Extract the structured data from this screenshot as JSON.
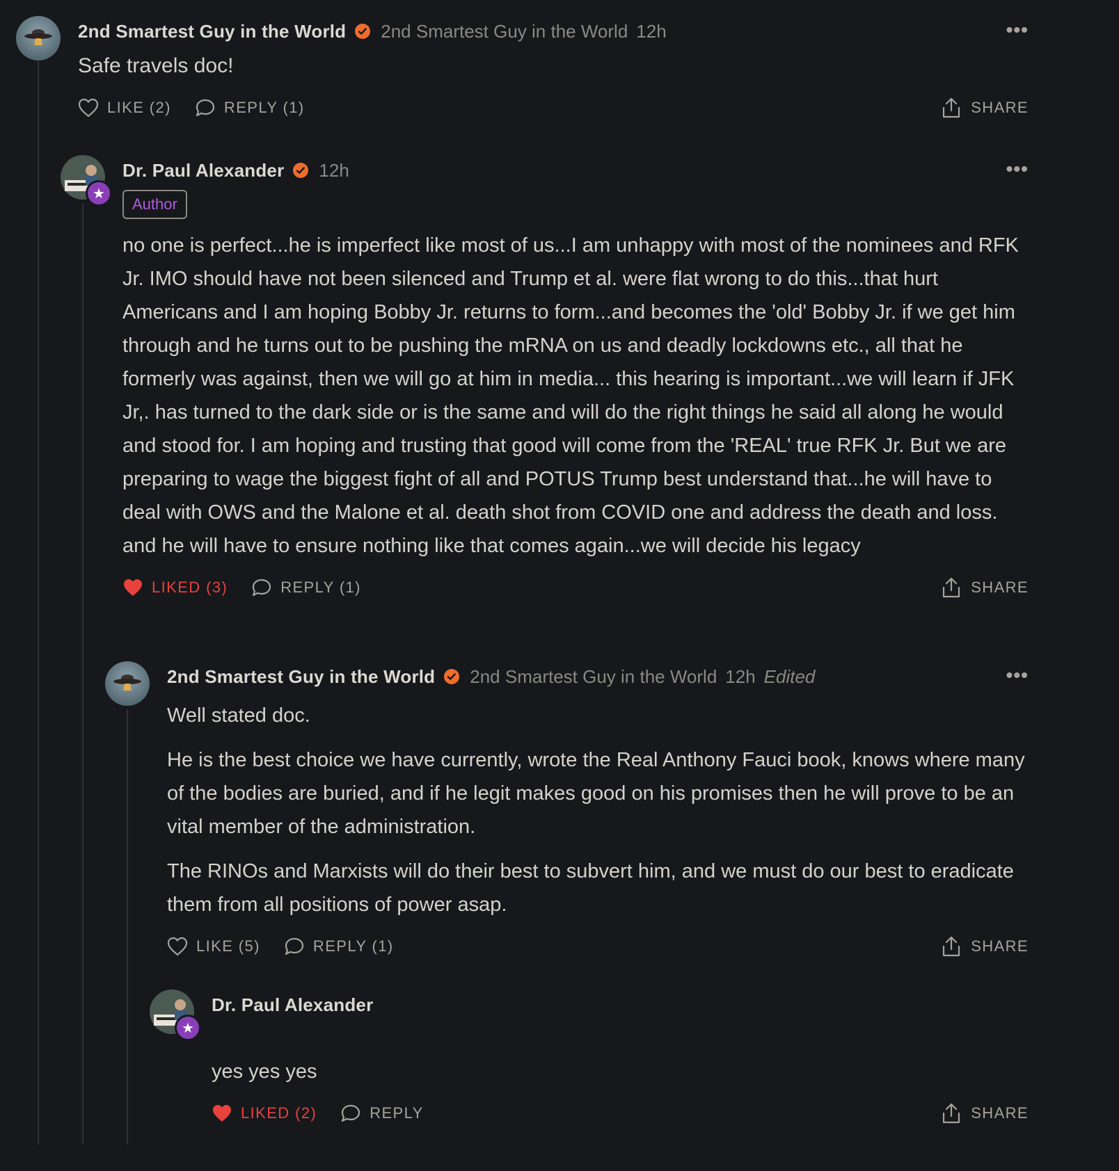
{
  "comments": [
    {
      "name": "2nd Smartest Guy in the World",
      "handle": "2nd Smartest Guy in the World",
      "time": "12h",
      "text": "Safe travels doc!",
      "like_label": "LIKE (2)",
      "reply_label": "REPLY (1)",
      "share_label": "SHARE"
    },
    {
      "name": "Dr. Paul Alexander",
      "time": "12h",
      "badge": "Author",
      "text": "no one is perfect...he is imperfect like most of us...I am unhappy with most of the nominees and RFK Jr. IMO should have not been silenced and Trump et al. were flat wrong to do this...that hurt Americans and I am hoping Bobby Jr. returns to form...and becomes the 'old' Bobby Jr. if we get him through and he turns out to be pushing the mRNA on us and deadly lockdowns etc., all that he formerly was against, then we will go at him in media... this hearing is important...we will learn if JFK Jr,. has turned to the dark side or is the same and will do the right things he said all along he would and stood for. I am hoping and trusting that good will come from the 'REAL' true RFK Jr. But we are preparing to wage the biggest fight of all and POTUS Trump best understand that...he will have to deal with OWS and the Malone et al. death shot from COVID one and address the death and loss. and he will have to ensure nothing like that comes again...we will decide his legacy",
      "like_label": "LIKED (3)",
      "reply_label": "REPLY (1)",
      "share_label": "SHARE"
    },
    {
      "name": "2nd Smartest Guy in the World",
      "handle": "2nd Smartest Guy in the World",
      "time": "12h",
      "edited": "Edited",
      "paragraphs": [
        "Well stated doc.",
        "He is the best choice we have currently, wrote the Real Anthony Fauci book, knows where many of the bodies are buried, and if he legit makes good on his promises then he will prove to be an vital member of the administration.",
        "The RINOs and Marxists will do their best to subvert him, and we must do our best to eradicate them from all positions of power asap."
      ],
      "like_label": "LIKE (5)",
      "reply_label": "REPLY (1)",
      "share_label": "SHARE"
    },
    {
      "name": "Dr. Paul Alexander",
      "text": "yes yes yes",
      "like_label": "LIKED (2)",
      "reply_label": "REPLY",
      "share_label": "SHARE"
    }
  ],
  "more_label": "•••",
  "colors": {
    "background": "#16181c",
    "verified": "#ef6d2c",
    "liked": "#e8423c",
    "author_badge": "#b15be0",
    "muted": "#8c8983"
  },
  "icons": [
    "verified-check-icon",
    "heart-outline-icon",
    "heart-filled-icon",
    "comment-bubble-icon",
    "share-upload-icon",
    "more-dots-icon",
    "star-icon"
  ]
}
